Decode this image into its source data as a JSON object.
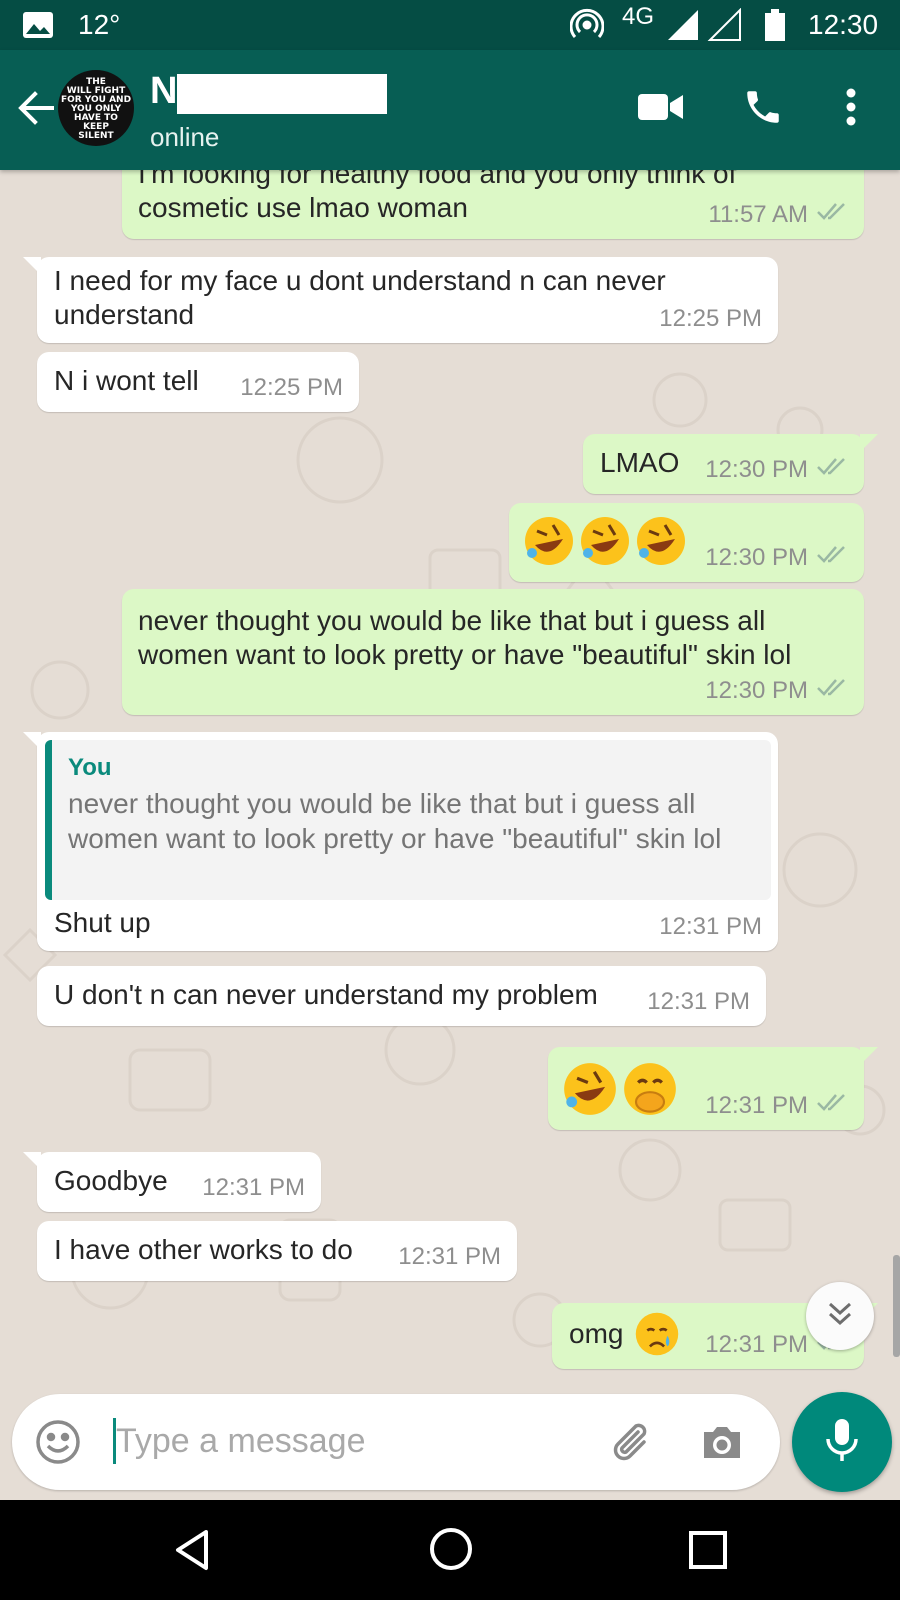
{
  "status_bar": {
    "temperature": "12°",
    "network": "4G",
    "time": "12:30"
  },
  "header": {
    "contact_initial": "N",
    "status": "online",
    "avatar_text": [
      "THE",
      "WILL FIGHT",
      "FOR YOU AND",
      "YOU ONLY",
      "HAVE TO",
      "KEEP",
      "SILENT"
    ]
  },
  "messages": [
    {
      "dir": "out",
      "text": "I'm looking for healthy food and you only think of\ncosmetic use lmao woman",
      "time": "11:57 AM"
    },
    {
      "dir": "in",
      "text": "I need for my face u dont understand n can never\nunderstand",
      "time": "12:25 PM"
    },
    {
      "dir": "in",
      "text": "N i wont tell",
      "time": "12:25 PM"
    },
    {
      "dir": "out",
      "text": "LMAO",
      "time": "12:30 PM"
    },
    {
      "dir": "out",
      "emoji": [
        "rofl",
        "rofl",
        "rofl"
      ],
      "time": "12:30 PM"
    },
    {
      "dir": "out",
      "text": "never thought you would be like that but i guess all\nwomen want to look pretty or have \"beautiful\" skin lol",
      "time": "12:30 PM"
    },
    {
      "dir": "in",
      "quote": {
        "author": "You",
        "text": "never thought you would be like that but i guess all women want to look pretty or have \"beautiful\" skin lol"
      },
      "text": "Shut up",
      "time": "12:31 PM"
    },
    {
      "dir": "in",
      "text": "U don't n can never understand my problem",
      "time": "12:31 PM"
    },
    {
      "dir": "out",
      "emoji": [
        "rofl",
        "hand-over-mouth"
      ],
      "time": "12:31 PM"
    },
    {
      "dir": "in",
      "text": "Goodbye",
      "time": "12:31 PM"
    },
    {
      "dir": "in",
      "text": "I have other works to do",
      "time": "12:31 PM"
    },
    {
      "dir": "out",
      "text": "omg",
      "emoji": [
        "crying-face"
      ],
      "time": "12:31 PM"
    }
  ],
  "input": {
    "placeholder": "Type a message"
  },
  "icons": {
    "header": [
      "back-arrow-icon",
      "video-call-icon",
      "voice-call-icon",
      "more-options-icon"
    ],
    "input": [
      "emoji-icon",
      "attach-icon",
      "camera-icon",
      "mic-icon"
    ],
    "nav": [
      "nav-back-icon",
      "nav-home-icon",
      "nav-recents-icon"
    ],
    "status": [
      "image-notification-icon",
      "hotspot-icon",
      "signal-icon",
      "battery-icon"
    ]
  },
  "colors": {
    "header": "#075e54",
    "status_bar": "#054d44",
    "outgoing_bubble": "#dcf8c6",
    "incoming_bubble": "#ffffff",
    "chat_background": "#e5ddd5",
    "accent": "#00897b",
    "read_ticks": "#8e8e8e"
  }
}
